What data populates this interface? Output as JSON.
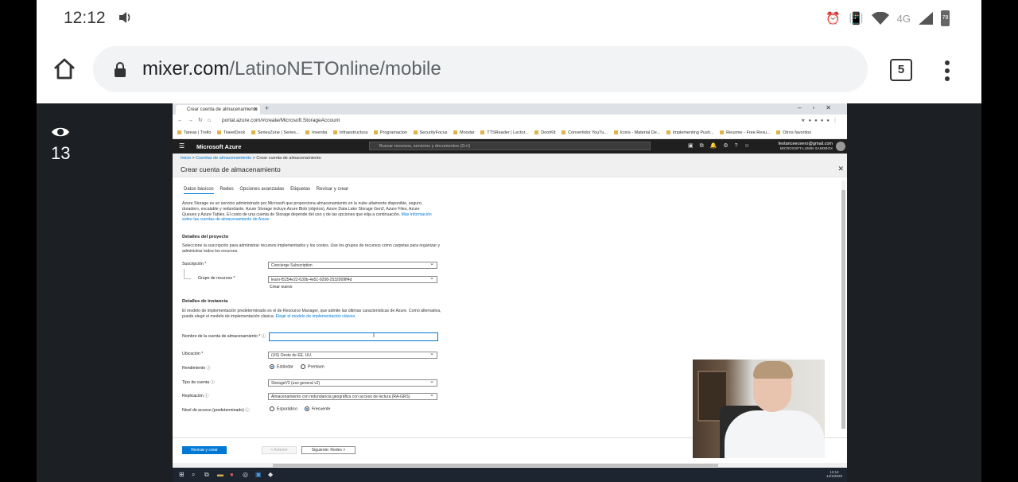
{
  "status_bar": {
    "time": "12:12",
    "network": "4G",
    "battery": "78"
  },
  "browser": {
    "url_host": "mixer.com",
    "url_path": "/LatinoNETOnline/mobile",
    "tab_count": "5"
  },
  "stream": {
    "viewer_count": "13"
  },
  "inner_browser": {
    "tab_title": "Crear cuenta de almacenamiento",
    "url": "portal.azure.com/#create/Microsoft.StorageAccount",
    "bookmarks": [
      "Tareas | Trello",
      "TweetDeck",
      "SeriesZone | Series...",
      "Inventia",
      "Infraestructura",
      "Programacion",
      "SecurityFocus",
      "Moodar",
      "TTSReader | Lector...",
      "DoorKit",
      "Convertidor YouTu...",
      "Icons - Material De...",
      "Implementing Push...",
      "Reusme - Free Resu...",
      "Otros favoritos"
    ]
  },
  "azure": {
    "brand": "Microsoft Azure",
    "search_placeholder": "Buscar recursos, servicios y documentos (G+/)",
    "user_email": "feotanceeceero@gmail.com",
    "user_org": "MICROSOFT-LUMIN SANDBOX",
    "breadcrumb": {
      "home": "Inicio",
      "parent": "Cuentas de almacenamiento",
      "current": "Crear cuenta de almacenamiento"
    },
    "title": "Crear cuenta de almacenamiento",
    "wizard_tabs": [
      "Datos básicos",
      "Redes",
      "Opciones avanzadas",
      "Etiquetas",
      "Revisar y crear"
    ],
    "description": "Azure Storage es un servicio administrado por Microsoft que proporciona almacenamiento en la nube altamente disponible, seguro, duradero, escalable y redundante. Azure Storage incluye Azure Blob (objetos), Azure Data Lake Storage Gen2, Azure Files, Azure Queues y Azure Tables. El costo de una cuenta de Storage depende del uso y de las opciones que elija a continuación.",
    "description_link": "Más información sobre las cuentas de almacenamiento de Azure",
    "project_heading": "Detalles del proyecto",
    "project_text": "Seleccione la suscripción para administrar recursos implementados y los costes. Use los grupos de recursos como carpetas para organizar y administrar todos los recursos.",
    "subscription_label": "Suscripción *",
    "subscription_value": "Concierge Subscription",
    "rg_label": "Grupo de recursos *",
    "rg_value": "learn-f5254e22-630b-4e51-9208-2532909ff4d",
    "create_new": "Crear nuevo",
    "instance_heading": "Detalles de instancia",
    "instance_text": "El modelo de implementación predeterminado es el de Resource Manager, que admite las últimas características de Azure. Como alternativa, puede elegir el modelo de implementación clásica.",
    "instance_link": "Elegir el modelo de implementación clásica",
    "name_label": "Nombre de la cuenta de almacenamiento",
    "location_label": "Ubicación *",
    "location_value": "(US) Oeste de EE. UU.",
    "performance_label": "Rendimiento",
    "perf_standard": "Estándar",
    "perf_premium": "Premium",
    "account_type_label": "Tipo de cuenta",
    "account_type_value": "StorageV2 (uso general v2)",
    "replication_label": "Replicación",
    "replication_value": "Almacenamiento con redundancia geográfica con acceso de lectura (RA-GRS)",
    "access_label": "Nivel de acceso (predeterminado)",
    "access_cool": "Esporádico",
    "access_hot": "Frecuente",
    "btn_review": "Revisar y crear",
    "btn_prev": "< Anterior",
    "btn_next": "Siguiente: Redes >"
  },
  "taskbar": {
    "time": "12:12",
    "date": "14/1/2020"
  }
}
